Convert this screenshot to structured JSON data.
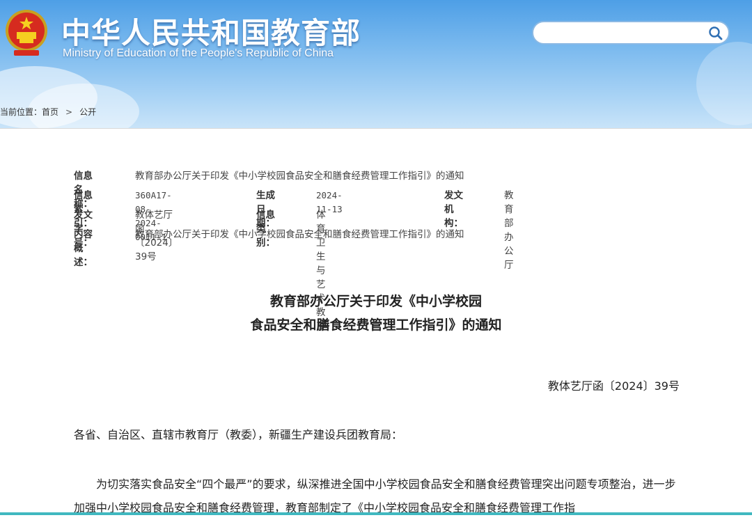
{
  "header": {
    "site_title": "中华人民共和国教育部",
    "site_subtitle": "Ministry of Education of the People's Republic of China",
    "emblem_icon": "national-emblem-icon",
    "search_placeholder": "",
    "search_icon": "search-icon"
  },
  "breadcrumb": {
    "prefix": "当前位置：",
    "items": [
      "首页",
      "公开"
    ],
    "separator": ">"
  },
  "meta": {
    "name_label": "信息名称：",
    "name_value": "教育部办公厅关于印发《中小学校园食品安全和膳食经费管理工作指引》的通知",
    "index_label": "信息索引：",
    "index_value": "360A17-08-2024-0011-1",
    "date_label": "生成日期：",
    "date_value": "2024-11-13",
    "org_label": "发文机构：",
    "org_value": "教育部办公厅",
    "docno_label": "发文字号：",
    "docno_value": "教体艺厅函〔2024〕39号",
    "category_label": "信息类别：",
    "category_value": "体育卫生与艺术教育",
    "summary_label": "内容概述：",
    "summary_value": "教育部办公厅关于印发《中小学校园食品安全和膳食经费管理工作指引》的通知"
  },
  "document": {
    "title_line1": "教育部办公厅关于印发《中小学校园",
    "title_line2": "食品安全和膳食经费管理工作指引》的通知",
    "number": "教体艺厅函〔2024〕39号",
    "salutation": "各省、自治区、直辖市教育厅（教委），新疆生产建设兵团教育局：",
    "paragraph1": "为切实落实食品安全“四个最严”的要求，纵深推进全国中小学校园食品安全和膳食经费管理突出问题专项整治，进一步加强中小学校园食品安全和膳食经费管理，教育部制定了《中小学校园食品安全和膳食经费管理工作指"
  },
  "colors": {
    "header_top": "#4e9fe6",
    "header_bottom": "#c9e4f9",
    "accent_bar": "#40b8c0"
  }
}
